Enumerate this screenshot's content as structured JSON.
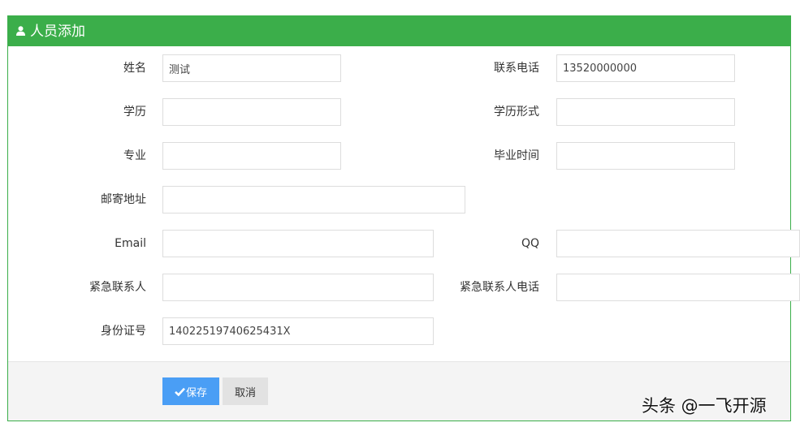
{
  "panel": {
    "title": "人员添加",
    "icon": "user-icon",
    "header_color": "#3bae4a"
  },
  "form": {
    "name": {
      "label": "姓名",
      "value": "测试"
    },
    "phone": {
      "label": "联系电话",
      "value": "13520000000"
    },
    "education": {
      "label": "学历",
      "value": ""
    },
    "education_type": {
      "label": "学历形式",
      "value": ""
    },
    "major": {
      "label": "专业",
      "value": ""
    },
    "graduation_time": {
      "label": "毕业时间",
      "value": ""
    },
    "mailing_address": {
      "label": "邮寄地址",
      "value": ""
    },
    "email": {
      "label": "Email",
      "value": ""
    },
    "qq": {
      "label": "QQ",
      "value": ""
    },
    "emergency_contact": {
      "label": "紧急联系人",
      "value": ""
    },
    "emergency_phone": {
      "label": "紧急联系人电话",
      "value": ""
    },
    "id_number": {
      "label": "身份证号",
      "value": "14022519740625431X"
    }
  },
  "actions": {
    "save_label": "保存",
    "save_icon": "check-icon",
    "save_color": "#4a9ef5",
    "cancel_label": "取消"
  },
  "watermark": "头条 @一飞开源"
}
